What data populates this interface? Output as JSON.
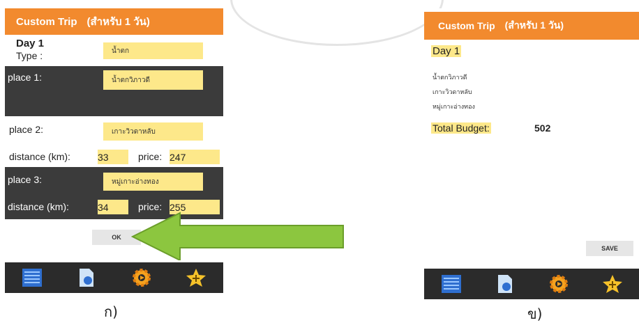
{
  "screen_a": {
    "title": "Custom Trip",
    "title_sub": "(สำหรับ 1 วัน)",
    "day_label": "Day 1",
    "type_label": "Type :",
    "type_value": "น้ำตก",
    "place1_label": "place 1:",
    "place1_value": "น้ำตกวิภาวดี",
    "place2_label": "place 2:",
    "place2_value": "เกาะวิวดาหลับ",
    "distance_label": "distance (km):",
    "price_label": "price:",
    "distance2": "33",
    "price2": "247",
    "place3_label": "place 3:",
    "place3_value": "หมู่เกาะอ่างทอง",
    "distance3": "34",
    "price3": "255",
    "ok_label": "OK",
    "caption": "ก)"
  },
  "screen_b": {
    "title": "Custom Trip",
    "title_sub": "(สำหรับ 1 วัน)",
    "day_label": "Day 1",
    "places": [
      "น้ำตกวิภาวดี",
      "เกาะวิวดาหลับ",
      "หมู่เกาะอ่างทอง"
    ],
    "budget_label": "Total Budget:",
    "budget_value": "502",
    "save_label": "SAVE",
    "caption": "ข)"
  },
  "nav_icons": [
    "list-icon",
    "document-icon",
    "settings-icon",
    "favorite-icon"
  ],
  "colors": {
    "title_bar": "#f28a2e",
    "highlight": "#fde88a",
    "dark_panel": "#3b3b3b",
    "nav_bar": "#2b2b2b",
    "arrow": "#8cc63f"
  }
}
